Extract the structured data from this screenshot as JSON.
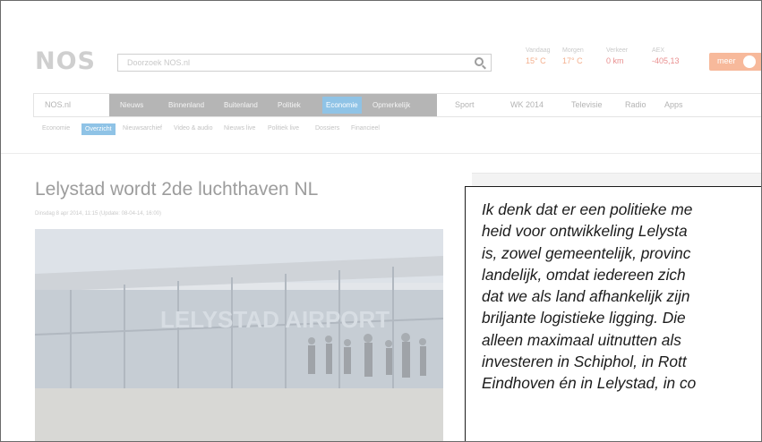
{
  "header": {
    "logo_text": "NOS",
    "search_placeholder": "Doorzoek NOS.nl",
    "weather": [
      {
        "label": "Vandaag",
        "value": "15° C"
      },
      {
        "label": "Morgen",
        "value": "17° C"
      },
      {
        "label": "Verkeer",
        "value": "0 km"
      },
      {
        "label": "AEX",
        "value": "-405,13"
      }
    ],
    "meer_label": "meer"
  },
  "nav": {
    "site": "NOS.nl",
    "dark_items": [
      "Nieuws",
      "Binnenland",
      "Buitenland",
      "Politiek",
      "Economie",
      "Opmerkelijk"
    ],
    "items": [
      "Sport",
      "WK 2014",
      "Televisie",
      "Radio",
      "Apps"
    ]
  },
  "subnav": {
    "items": [
      "Economie",
      "Overzicht",
      "Nieuwsarchief",
      "Video & audio",
      "Nieuws live",
      "Politiek live",
      "Dossiers",
      "Financieel"
    ]
  },
  "article": {
    "title": "Lelystad wordt 2de luchthaven NL",
    "meta": "Dinsdag 8 apr 2014, 11:15 (Update: 08-04-14, 16:00)",
    "photo_sign": "LELYSTAD AIRPORT"
  },
  "quote": {
    "lines": [
      "Ik denk dat er een politieke me",
      "heid voor ontwikkeling Lelysta",
      "is, zowel gemeentelijk, provinc",
      "landelijk, omdat iedereen zich",
      "dat we als land afhankelijk zijn",
      "briljante logistieke ligging. Die",
      "alleen maximaal uitnutten als",
      "investeren in Schiphol,  in Rott",
      "Eindhoven én in Lelystad, in co"
    ]
  },
  "colors": {
    "logo": "#cfcfcf",
    "accent_blue": "#8fc3e6",
    "orange": "#f7b99b",
    "quote_border": "#1b1b1b"
  }
}
